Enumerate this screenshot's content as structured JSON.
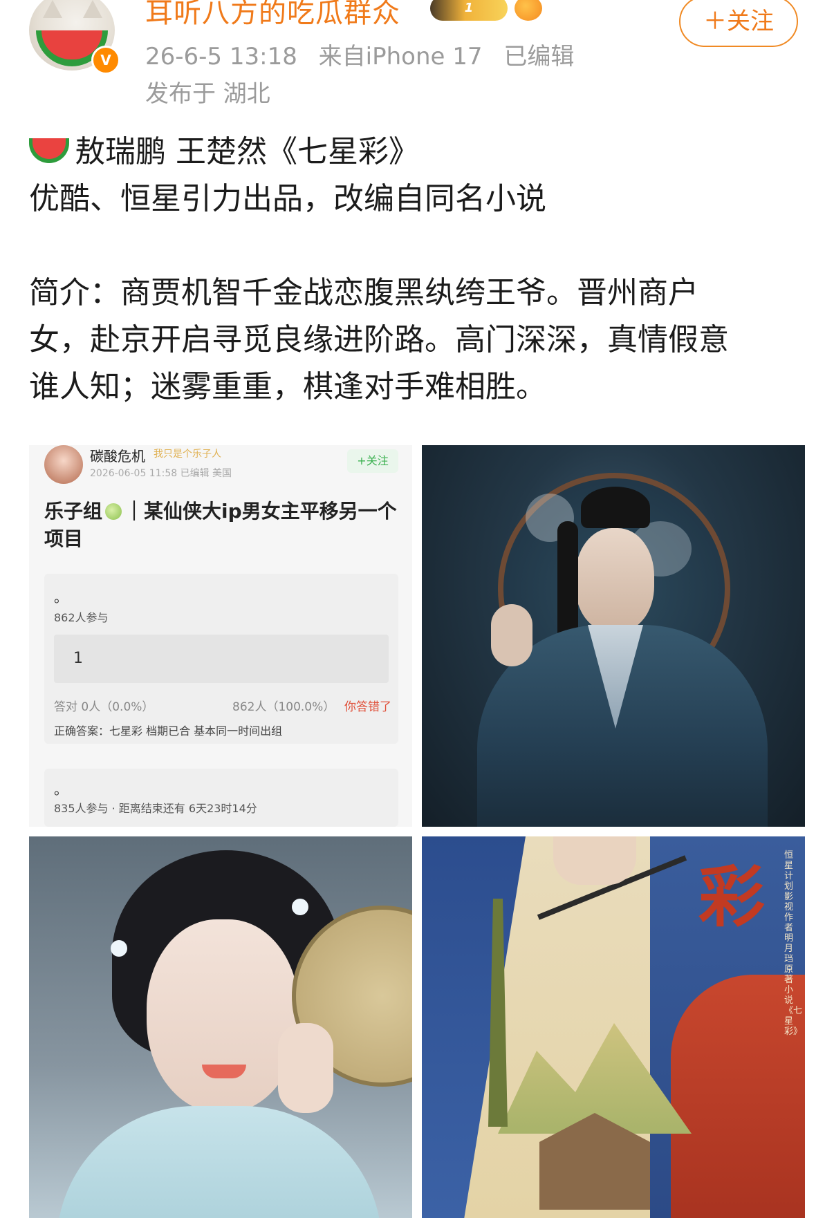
{
  "header": {
    "username": "耳听八方的吃瓜群众",
    "badge_level": "1",
    "verified_mark": "V",
    "timestamp": "26-6-5 13:18",
    "source": "来自iPhone 17",
    "edited": "已编辑",
    "location": "发布于 湖北",
    "follow_label": "＋关注"
  },
  "post": {
    "line1": "敖瑞鹏 王楚然《七星彩》",
    "line2": "优酷、恒星引力出品，改编自同名小说",
    "line3": "简介：商贾机智千金战恋腹黑纨绔王爷。晋州商户",
    "line4": "女，赴京开启寻觅良缘进阶路。高门深深，真情假意",
    "line5": "谁人知；迷雾重重，棋逢对手难相胜。"
  },
  "poll_screenshot": {
    "author": "碳酸危机",
    "author_tag": "我只是个乐子人",
    "meta": "2026-06-05 11:58 已编辑 美国",
    "follow_label": "+关注",
    "title_part1": "乐子组",
    "title_part2": "｜某仙侠大ip男女主平移另一个项目",
    "card1": {
      "question": "。",
      "participants": "862人参与",
      "option": "1",
      "correct_stat": "答对 0人（0.0%）",
      "wrong_stat": "862人（100.0%）",
      "wrong_label": "你答错了",
      "answer": "正确答案：七星彩 档期已合 基本同一时间出组"
    },
    "card2": {
      "question": "。",
      "participants": "835人参与 · 距离结束还有 6天23时14分"
    }
  },
  "poster": {
    "title_glyph": "彩",
    "side_text": "恒星计划 影视作者 明月珰 原著小说《七星彩》"
  },
  "colors": {
    "accent_orange": "#f07a1a",
    "meta_gray": "#9b9b9b",
    "poll_green": "#3bb150",
    "poll_red": "#e0503a"
  }
}
